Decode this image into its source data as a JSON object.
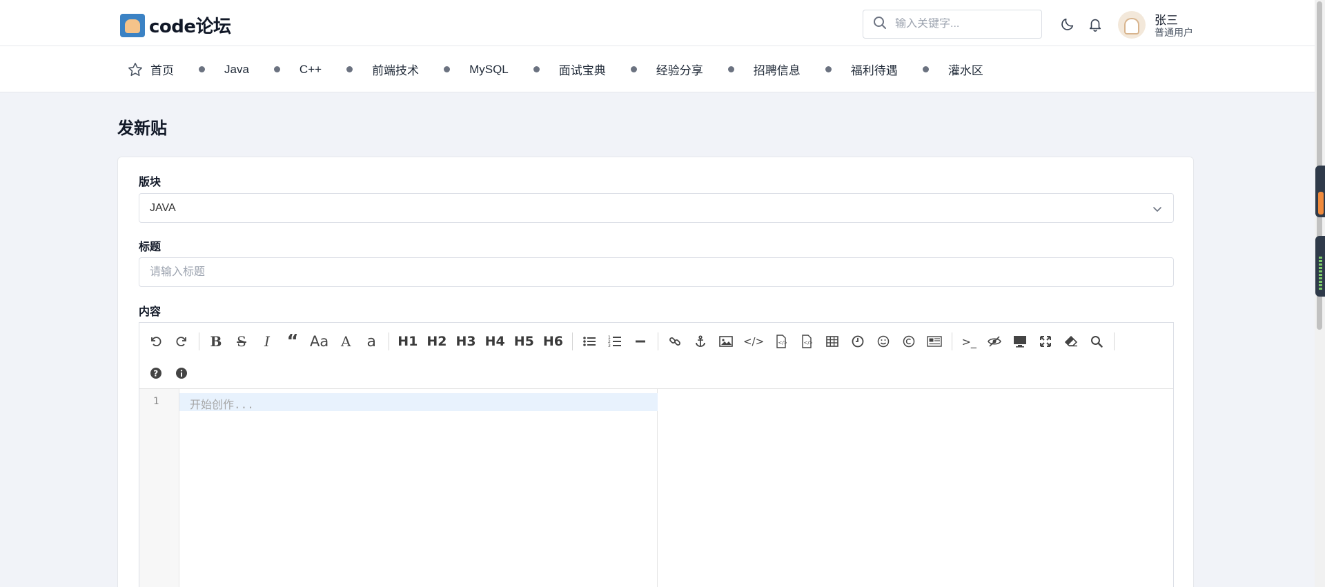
{
  "header": {
    "logo_text": "code论坛",
    "search_placeholder": "输入关键字...",
    "user_name": "张三",
    "user_role": "普通用户"
  },
  "nav": {
    "home": "首页",
    "items": [
      "Java",
      "C++",
      "前端技术",
      "MySQL",
      "面试宝典",
      "经验分享",
      "招聘信息",
      "福利待遇",
      "灌水区"
    ]
  },
  "page": {
    "title": "发新贴"
  },
  "form": {
    "board_label": "版块",
    "board_value": "JAVA",
    "title_label": "标题",
    "title_placeholder": "请输入标题",
    "content_label": "内容"
  },
  "editor": {
    "toolbar_row1": [
      "undo-icon",
      "redo-icon",
      "|",
      "bold-icon",
      "strikethrough-icon",
      "italic-icon",
      "quote-icon",
      "uppercase-icon",
      "uppercase-first-icon",
      "lowercase-icon",
      "|",
      "H1",
      "H2",
      "H3",
      "H4",
      "H5",
      "H6",
      "|",
      "unordered-list-icon",
      "ordered-list-icon",
      "horizontal-rule-icon",
      "|",
      "link-icon",
      "anchor-icon",
      "image-icon",
      "inline-code-icon",
      "code-block-icon",
      "code-preformatted-icon",
      "table-icon",
      "datetime-icon",
      "emoji-icon",
      "html-entities-icon",
      "pagebreak-icon",
      "|",
      "goto-line-icon",
      "watch-icon",
      "preview-icon",
      "fullscreen-icon",
      "clear-icon",
      "search-icon"
    ],
    "toolbar_row2": [
      "help-icon",
      "info-icon"
    ],
    "heading_labels": {
      "h1": "H1",
      "h2": "H2",
      "h3": "H3",
      "h4": "H4",
      "h5": "H5",
      "h6": "H6"
    },
    "case_labels": {
      "upper_all": "Aa",
      "upper_first": "A",
      "lower": "a"
    },
    "line_number": "1",
    "placeholder": "开始创作..."
  },
  "colors": {
    "page_bg": "#f1f3f8",
    "active_line": "#e8f2fd",
    "scroll_widget_orange": "#f08a3c",
    "scroll_widget_dark": "#2f3a4a"
  }
}
